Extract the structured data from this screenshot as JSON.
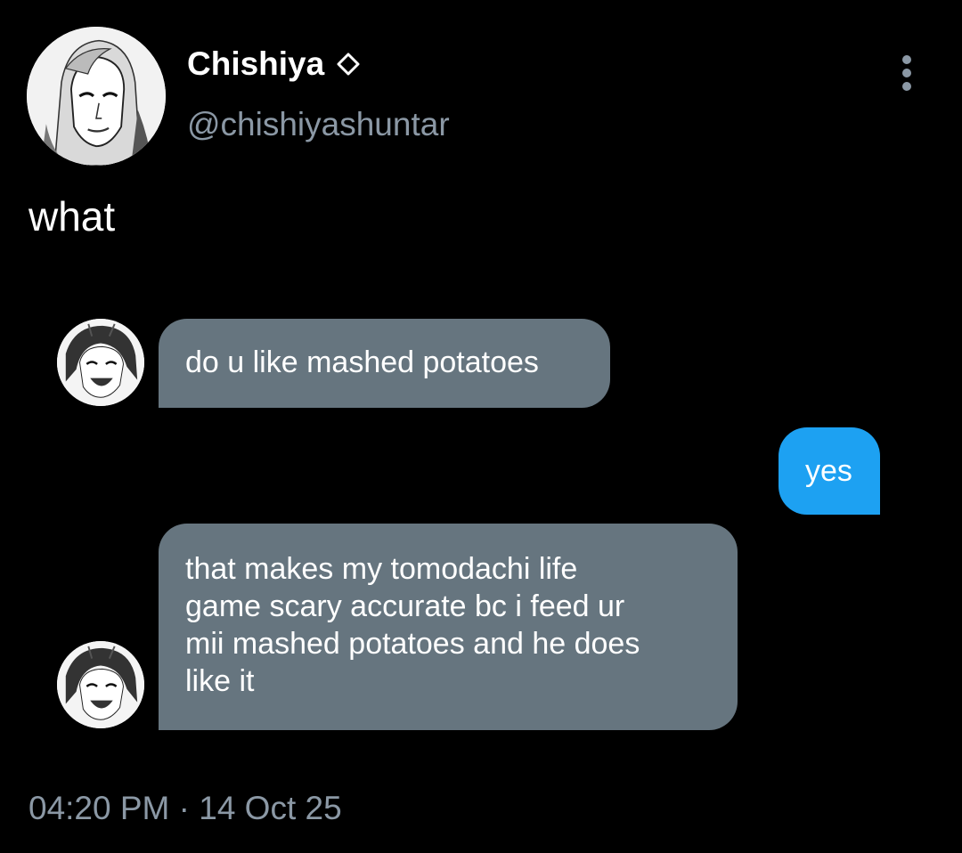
{
  "profile": {
    "display_name": "Chishiya",
    "handle": "@chishiyashuntar",
    "badge_icon": "diamond-outline-icon",
    "avatar": "avatar-manga-portrait"
  },
  "tweet": {
    "text": "what",
    "timestamp": "04:20 PM · 14 Oct 25"
  },
  "menu": {
    "icon": "more-vertical-icon"
  },
  "conversation": {
    "messages": [
      {
        "side": "incoming",
        "text": "do u like mashed potatoes"
      },
      {
        "side": "outgoing",
        "text": "yes"
      },
      {
        "side": "incoming",
        "text": "that makes my tomodachi life\ngame scary accurate bc i feed ur\nmii mashed potatoes and he does\nlike it"
      }
    ]
  },
  "colors": {
    "background": "#000000",
    "incoming_bubble": "#66757f",
    "outgoing_bubble": "#1da1f2",
    "secondary_text": "#8b98a5",
    "primary_text": "#ffffff"
  }
}
